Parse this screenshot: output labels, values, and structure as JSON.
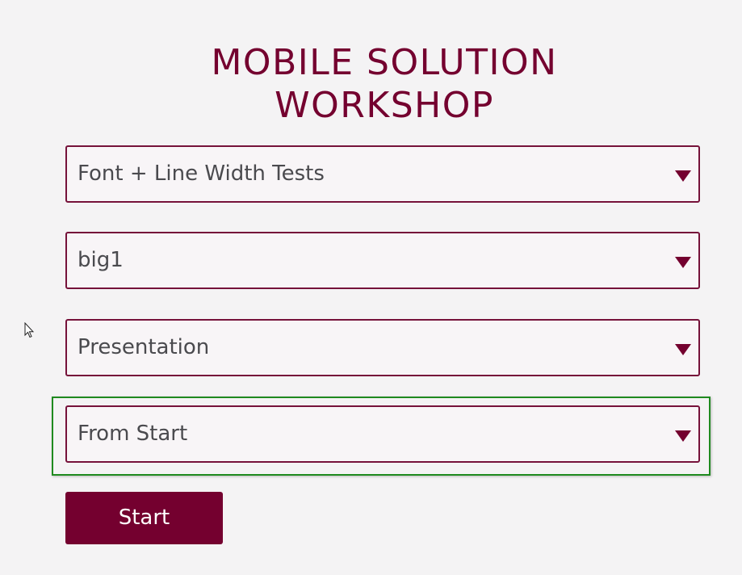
{
  "header": {
    "title_line1": "MOBILE SOLUTION",
    "title_line2": "WORKSHOP"
  },
  "selects": {
    "s1": {
      "value": "Font + Line Width Tests"
    },
    "s2": {
      "value": "big1"
    },
    "s3": {
      "value": "Presentation"
    },
    "s4": {
      "value": "From Start"
    }
  },
  "buttons": {
    "start_label": "Start"
  },
  "colors": {
    "brand": "#74002f",
    "focus": "#1f8a1f",
    "background": "#f4f3f4",
    "text": "#4a4a4e"
  },
  "icons": {
    "dropdown": "caret-down-icon",
    "pointer": "mouse-cursor-icon"
  }
}
